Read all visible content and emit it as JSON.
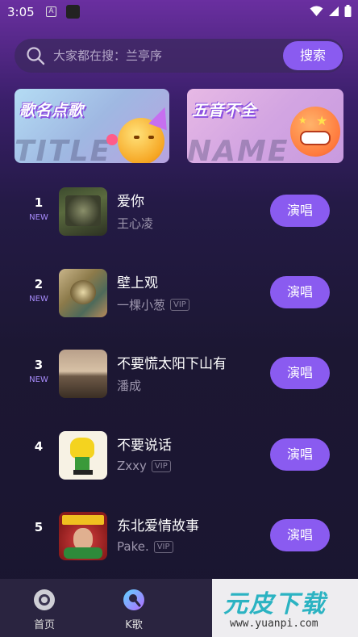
{
  "status_bar": {
    "time": "3:05",
    "notification_glyph": "A"
  },
  "search": {
    "placeholder": "大家都在搜：兰亭序",
    "button_label": "搜索"
  },
  "banners": [
    {
      "title": "歌名点歌",
      "bg_text": "TITLE"
    },
    {
      "title": "五音不全",
      "bg_text": "NAME"
    }
  ],
  "songs": [
    {
      "rank": "1",
      "tag": "NEW",
      "title": "爱你",
      "artist": "王心凌",
      "vip": "",
      "action": "演唱"
    },
    {
      "rank": "2",
      "tag": "NEW",
      "title": "壁上观",
      "artist": "一棵小葱",
      "vip": "VIP",
      "action": "演唱"
    },
    {
      "rank": "3",
      "tag": "NEW",
      "title": "不要慌太阳下山有",
      "artist": "潘成",
      "vip": "",
      "action": "演唱"
    },
    {
      "rank": "4",
      "tag": "",
      "title": "不要说话",
      "artist": "Zxxy",
      "vip": "VIP",
      "action": "演唱"
    },
    {
      "rank": "5",
      "tag": "",
      "title": "东北爱情故事",
      "artist": "Pake.",
      "vip": "VIP",
      "action": "演唱"
    }
  ],
  "bottom_nav": [
    {
      "label": "首页",
      "icon": "music-disc-icon",
      "active": false
    },
    {
      "label": "K歌",
      "icon": "microphone-icon",
      "active": true
    }
  ],
  "watermark": {
    "brand": "元皮下载",
    "url": "www.yuanpi.com"
  },
  "colors": {
    "accent": "#8a5bf0",
    "new_tag": "#a78bfa",
    "background": "#1c1733"
  }
}
